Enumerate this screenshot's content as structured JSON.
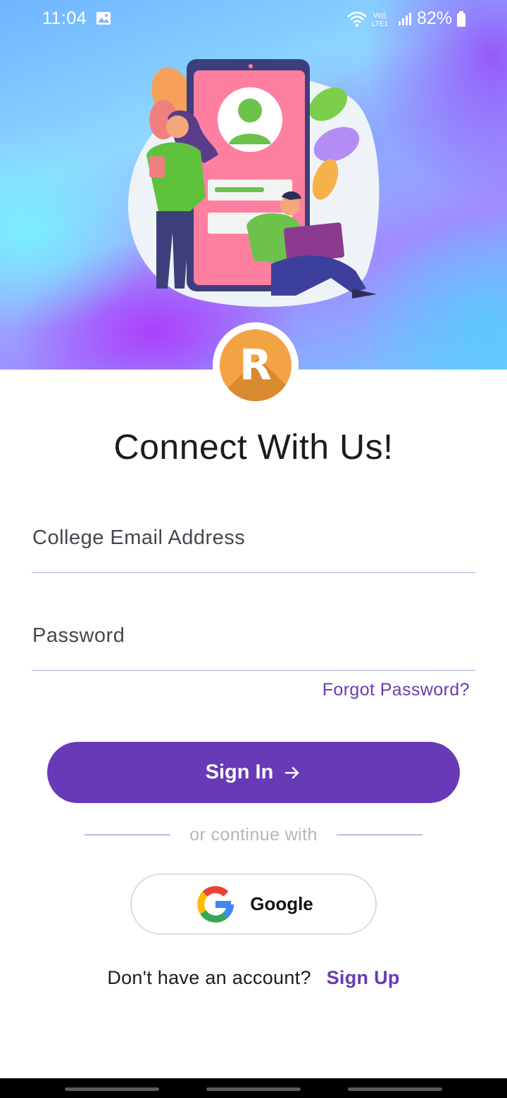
{
  "status_bar": {
    "time": "11:04",
    "battery": "82%",
    "net_label_top": "Vo))",
    "net_label_bottom": "LTE1"
  },
  "hero": {
    "illustration": "person-profile-login-illustration",
    "logo_letter": "R"
  },
  "title": "Connect With Us!",
  "form": {
    "email_placeholder": "College Email Address",
    "email_value": "",
    "password_placeholder": "Password",
    "password_value": "",
    "forgot_label": "Forgot Password?",
    "signin_label": "Sign In"
  },
  "divider_text": "or continue with",
  "google_label": "Google",
  "signup": {
    "prompt": "Don't have an account?",
    "link_label": "Sign Up"
  },
  "colors": {
    "primary": "#673ab7",
    "logo": "#f2a445",
    "link": "#6a3ab0"
  }
}
